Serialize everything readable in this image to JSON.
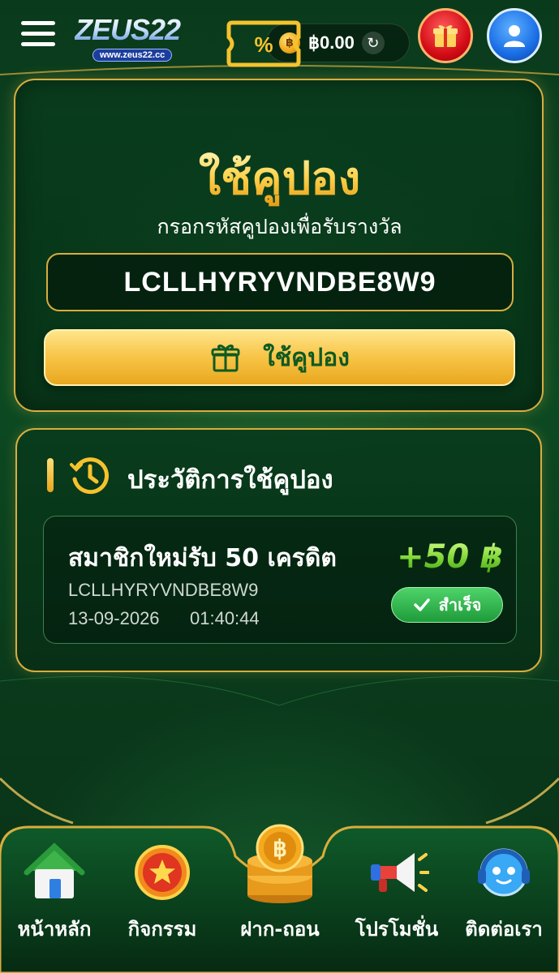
{
  "header": {
    "logo_text": "ZEUS22",
    "logo_url": "www.zeus22.cc",
    "balance": "฿0.00"
  },
  "coupon": {
    "title": "ใช้คูปอง",
    "subtitle": "กรอกรหัสคูปองเพื่อรับรางวัล",
    "code_value": "LCLLHYRYVNDBE8W9",
    "button_label": "ใช้คูปอง"
  },
  "history": {
    "title": "ประวัติการใช้คูปอง",
    "items": [
      {
        "title": "สมาชิกใหม่รับ 50 เครดิต",
        "code": "LCLLHYRYVNDBE8W9",
        "date": "13-09-2026",
        "time": "01:40:44",
        "amount": "+50 ฿",
        "status": "สำเร็จ"
      }
    ]
  },
  "nav": {
    "items": [
      {
        "label": "หน้าหลัก",
        "icon": "home-icon"
      },
      {
        "label": "กิจกรรม",
        "icon": "star-badge-icon"
      },
      {
        "label": "ฝาก-ถอน",
        "icon": "coin-stack-icon"
      },
      {
        "label": "โปรโมชั่น",
        "icon": "megaphone-icon"
      },
      {
        "label": "ติดต่อเรา",
        "icon": "support-headset-icon"
      }
    ]
  },
  "colors": {
    "accent_gold": "#d8ad3f",
    "background_green": "#0c4a22",
    "success_green": "#1e9b3a",
    "button_text_green": "#0f5a22"
  }
}
